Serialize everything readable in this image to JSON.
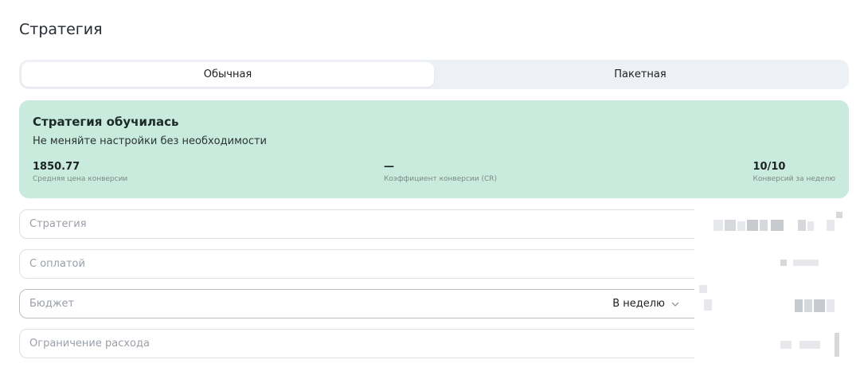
{
  "header": {
    "title": "Стратегия"
  },
  "tabs": [
    {
      "label": "Обычная",
      "active": true
    },
    {
      "label": "Пакетная",
      "active": false
    }
  ],
  "status": {
    "title": "Стратегия обучилась",
    "subtitle": "Не меняйте настройки без необходимости",
    "metrics": [
      {
        "value": "1850.77",
        "label": "Средняя цена конверсии"
      },
      {
        "value": "—",
        "label": "Коэффициент конверсии (CR)"
      },
      {
        "value": "10/10",
        "label": "Конверсий за неделю"
      }
    ]
  },
  "fields": {
    "strategy": {
      "placeholder": "Стратегия"
    },
    "payment": {
      "placeholder": "С оплатой"
    },
    "budget": {
      "placeholder": "Бюджет",
      "period": "В неделю"
    },
    "limit": {
      "placeholder": "Ограничение расхода"
    }
  },
  "colors": {
    "status_bg": "#c8ebdd",
    "tabs_bg": "#edf0f4"
  }
}
